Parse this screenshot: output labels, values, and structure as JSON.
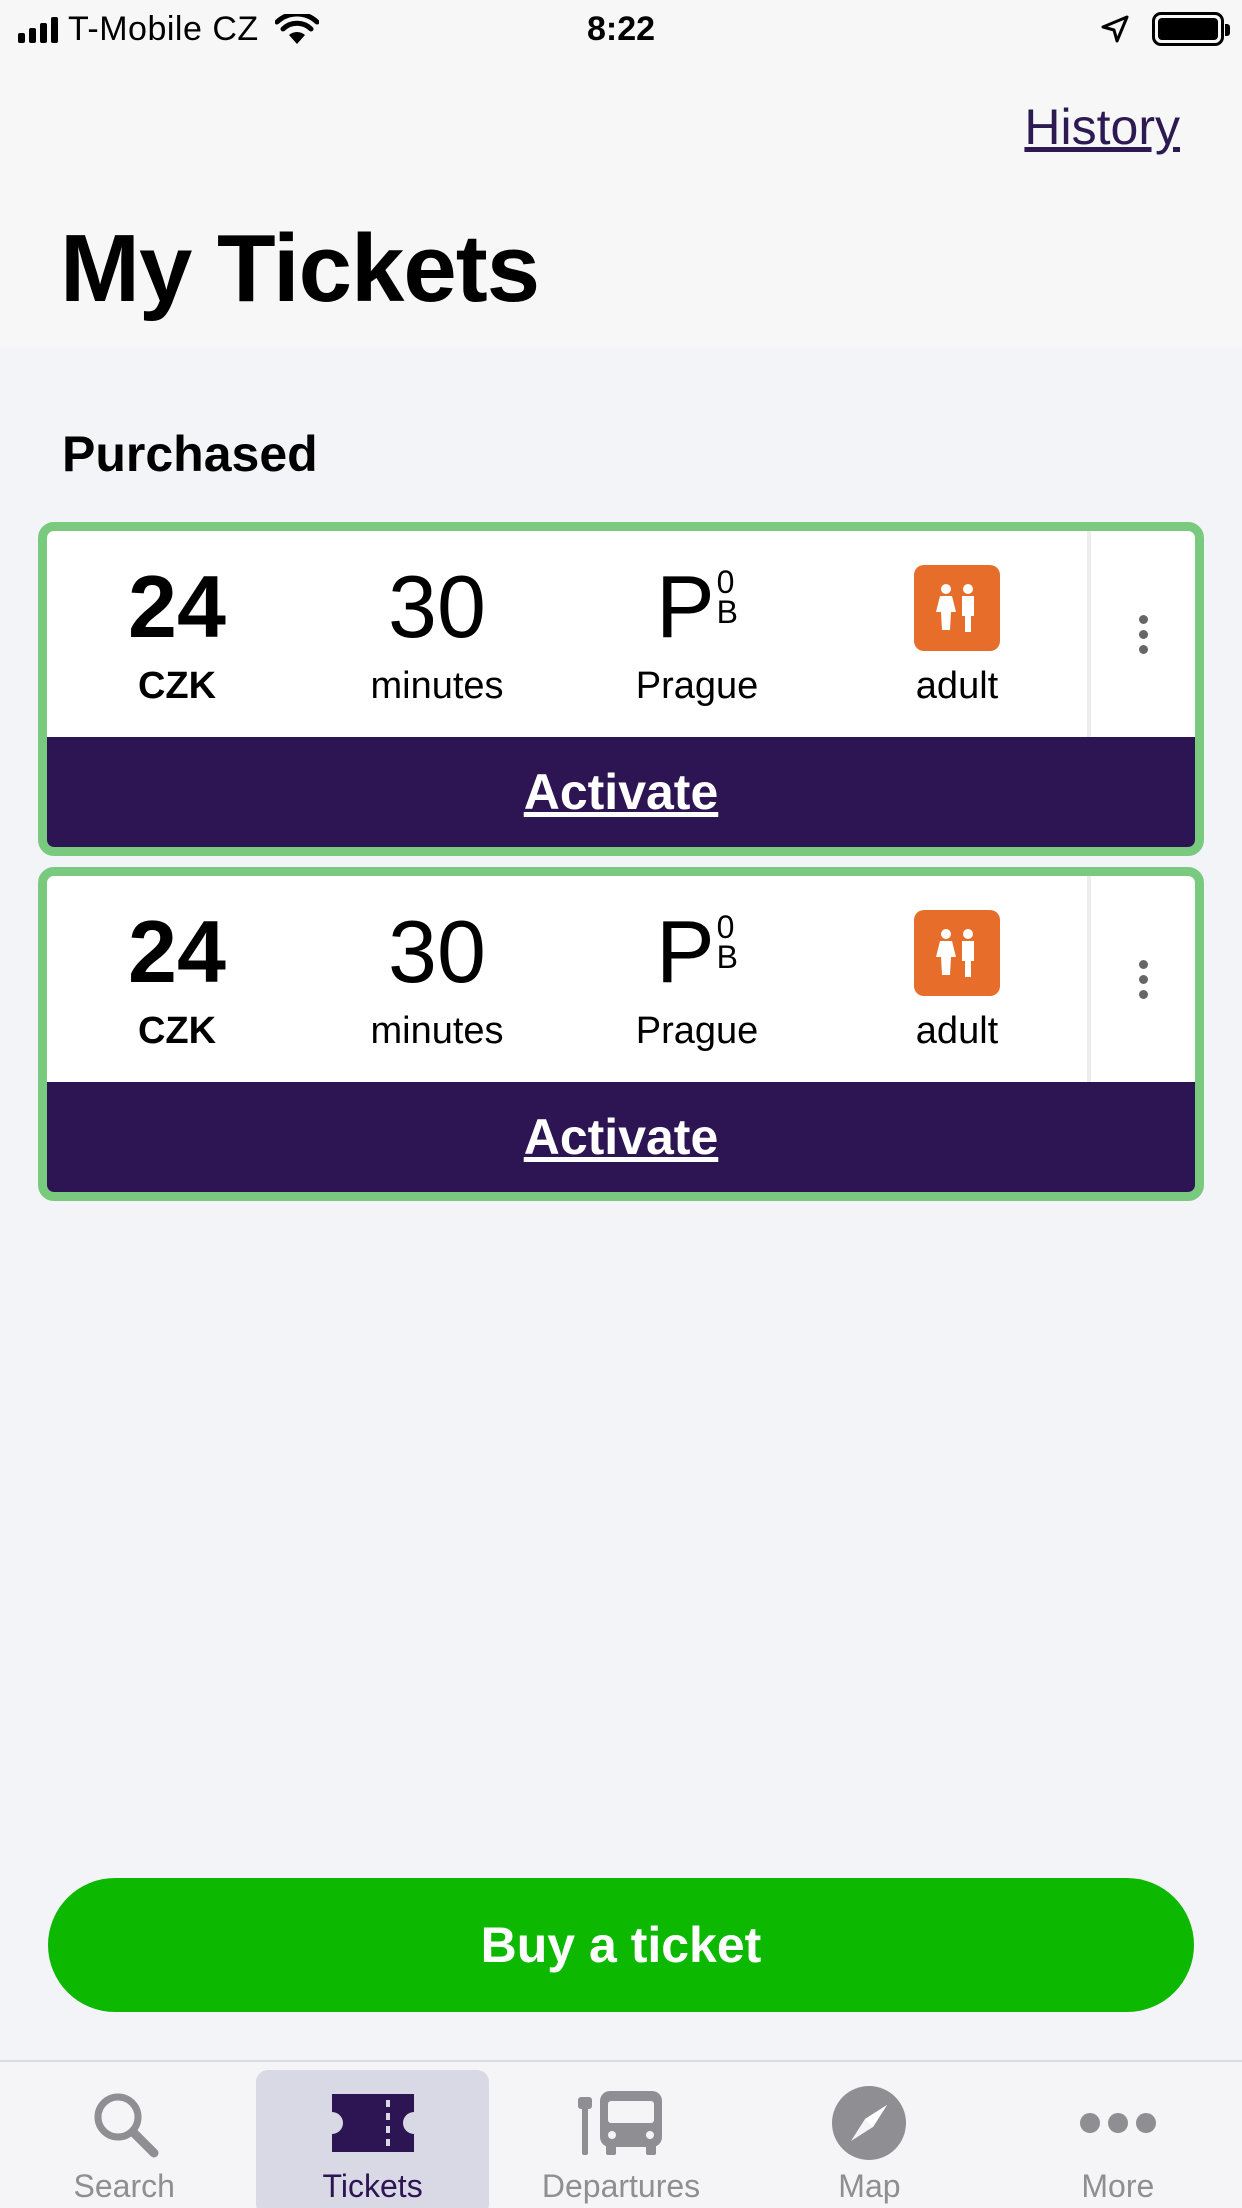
{
  "status_bar": {
    "carrier": "T-Mobile CZ",
    "time": "8:22"
  },
  "header": {
    "history_label": "History",
    "title": "My Tickets"
  },
  "section_title": "Purchased",
  "tickets": [
    {
      "price": "24",
      "currency": "CZK",
      "duration": "30",
      "duration_unit": "minutes",
      "zone_letter": "P",
      "zone_sup": "0",
      "zone_sub": "B",
      "zone_name": "Prague",
      "passenger": "adult",
      "activate_label": "Activate"
    },
    {
      "price": "24",
      "currency": "CZK",
      "duration": "30",
      "duration_unit": "minutes",
      "zone_letter": "P",
      "zone_sup": "0",
      "zone_sub": "B",
      "zone_name": "Prague",
      "passenger": "adult",
      "activate_label": "Activate"
    }
  ],
  "buy_button_label": "Buy a ticket",
  "tab_bar": {
    "items": [
      {
        "label": "Search",
        "icon": "search-icon",
        "active": false
      },
      {
        "label": "Tickets",
        "icon": "ticket-icon",
        "active": true
      },
      {
        "label": "Departures",
        "icon": "bus-stop-icon",
        "active": false
      },
      {
        "label": "Map",
        "icon": "compass-icon",
        "active": false
      },
      {
        "label": "More",
        "icon": "more-icon",
        "active": false
      }
    ]
  },
  "colors": {
    "accent_purple": "#2d1452",
    "card_border": "#79c97f",
    "buy_green": "#0db800",
    "passenger_orange": "#e76d2a"
  }
}
